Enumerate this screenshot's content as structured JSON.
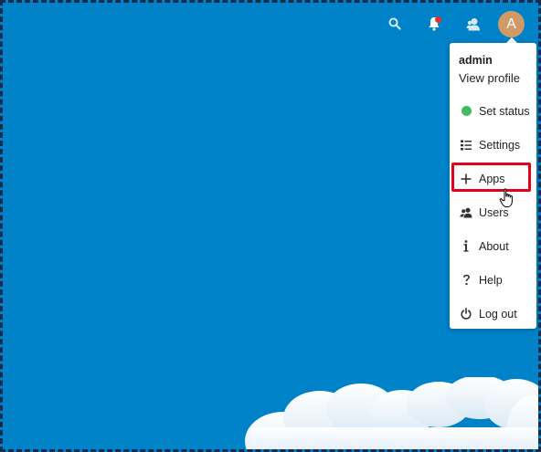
{
  "header": {
    "icons": [
      "search-icon",
      "notifications-icon",
      "contacts-icon"
    ],
    "avatar_initial": "A",
    "colors": {
      "background": "#0082c9",
      "avatar": "#d09a66",
      "notification_dot": "#e9322d"
    }
  },
  "menu": {
    "username": "admin",
    "view_profile": "View profile",
    "items": [
      {
        "label": "Set status",
        "icon": "status-dot-icon"
      },
      {
        "label": "Settings",
        "icon": "settings-list-icon"
      },
      {
        "label": "Apps",
        "icon": "plus-icon"
      },
      {
        "label": "Users",
        "icon": "users-icon"
      },
      {
        "label": "About",
        "icon": "info-icon"
      },
      {
        "label": "Help",
        "icon": "help-icon"
      },
      {
        "label": "Log out",
        "icon": "power-icon"
      }
    ],
    "highlighted_item": "Apps",
    "colors": {
      "status": "#46ba61",
      "highlight": "#e2001a"
    }
  }
}
